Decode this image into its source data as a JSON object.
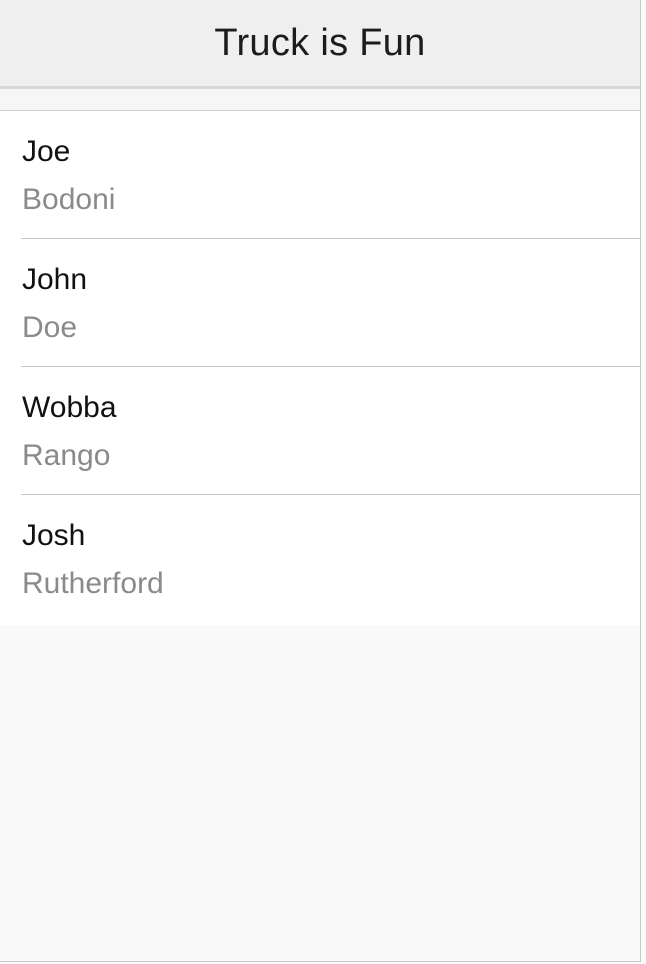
{
  "navbar": {
    "title": "Truck is Fun"
  },
  "list": {
    "items": [
      {
        "first_name": "Joe",
        "last_name": "Bodoni"
      },
      {
        "first_name": "John",
        "last_name": "Doe"
      },
      {
        "first_name": "Wobba",
        "last_name": "Rango"
      },
      {
        "first_name": "Josh",
        "last_name": "Rutherford"
      }
    ]
  }
}
